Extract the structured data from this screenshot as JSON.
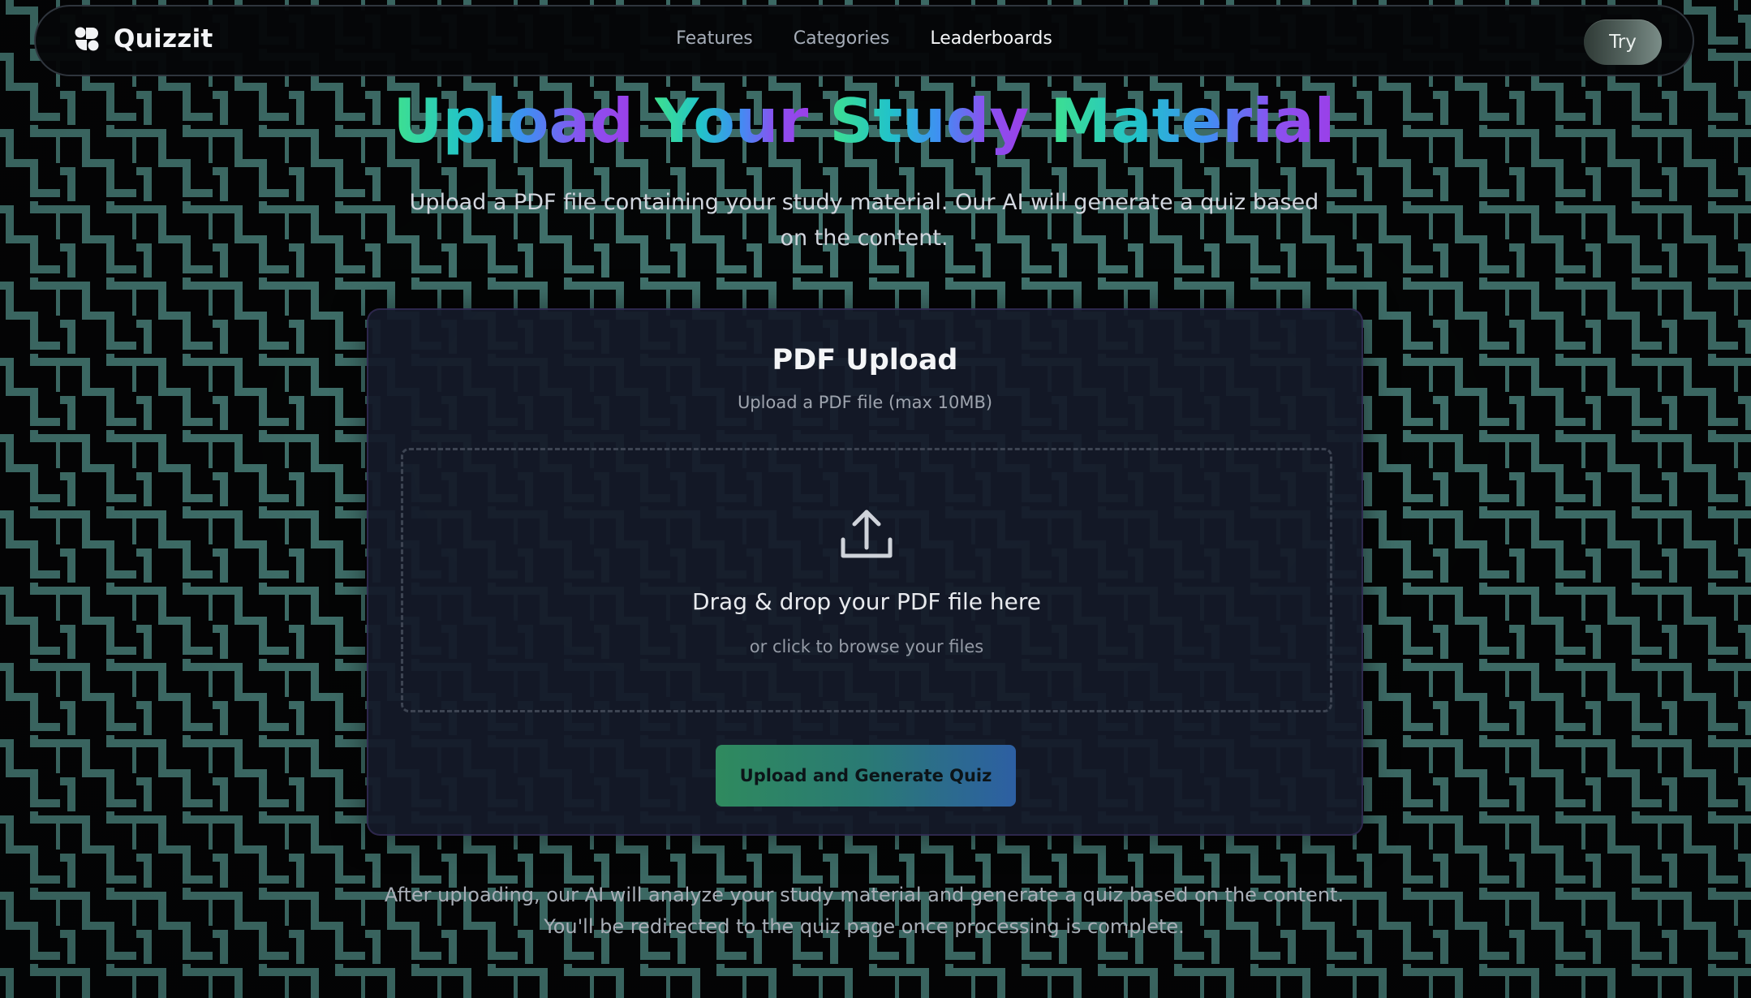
{
  "nav": {
    "brand": "Quizzit",
    "links": [
      {
        "label": "Features"
      },
      {
        "label": "Categories"
      },
      {
        "label": "Leaderboards"
      }
    ],
    "try_label": "Try"
  },
  "hero": {
    "title_words": [
      "Upload",
      "Your",
      "Study",
      "Material"
    ],
    "subtitle": "Upload a PDF file containing your study material. Our AI will generate a quiz based on the content."
  },
  "upload_card": {
    "title": "PDF Upload",
    "subtitle": "Upload a PDF file (max 10MB)",
    "dropzone": {
      "icon": "upload-icon",
      "title": "Drag & drop your PDF file here",
      "subtitle": "or click to browse your files"
    },
    "button_label": "Upload and Generate Quiz"
  },
  "footer_note": "After uploading, our AI will analyze your study material and generate a quiz based on the content. You'll be redirected to the quiz page once processing is complete.",
  "colors": {
    "background": "#050607",
    "pattern": "#5fa8a0",
    "title_gradient": [
      "#3ee08f",
      "#22c3c9",
      "#3f8ff2",
      "#9b3fe8"
    ],
    "button_gradient": [
      "#2f8a5e",
      "#2d5fa3"
    ]
  }
}
